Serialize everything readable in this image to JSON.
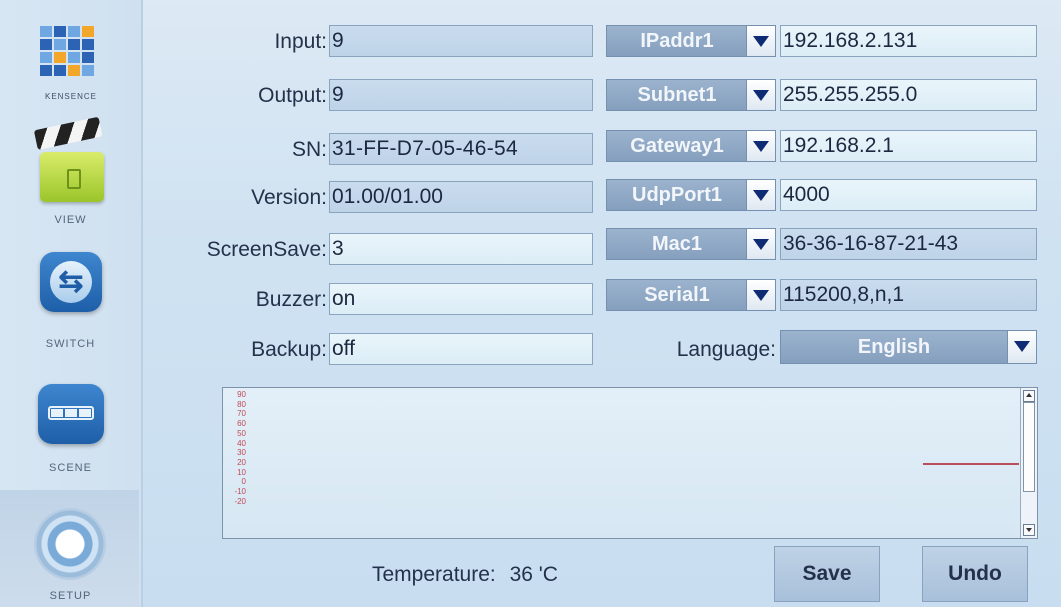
{
  "sidebar": {
    "brand": "KENSENCE",
    "items": [
      {
        "label": "VIEW"
      },
      {
        "label": "SWITCH"
      },
      {
        "label": "SCENE"
      },
      {
        "label": "SETUP",
        "selected": true
      }
    ]
  },
  "info": {
    "input_label": "Input:",
    "input_value": "9",
    "output_label": "Output:",
    "output_value": "9",
    "sn_label": "SN:",
    "sn_value": "31-FF-D7-05-46-54",
    "version_label": "Version:",
    "version_value": "01.00/01.00",
    "screensave_label": "ScreenSave:",
    "screensave_value": "3",
    "buzzer_label": "Buzzer:",
    "buzzer_value": "on",
    "backup_label": "Backup:",
    "backup_value": "off"
  },
  "network": {
    "ipaddr_label": "IPaddr1",
    "ipaddr_value": "192.168.2.131",
    "subnet_label": "Subnet1",
    "subnet_value": "255.255.255.0",
    "gateway_label": "Gateway1",
    "gateway_value": "192.168.2.1",
    "udpport_label": "UdpPort1",
    "udpport_value": "4000",
    "mac_label": "Mac1",
    "mac_value": "36-36-16-87-21-43",
    "serial_label": "Serial1",
    "serial_value": "115200,8,n,1",
    "language_label": "Language:",
    "language_value": "English"
  },
  "graph": {
    "axis_ticks": [
      "90",
      "80",
      "70",
      "60",
      "50",
      "40",
      "30",
      "20",
      "10",
      "0",
      "-10",
      "-20"
    ]
  },
  "footer": {
    "temperature_label": "Temperature:",
    "temperature_value": "36 'C",
    "save_label": "Save",
    "undo_label": "Undo"
  },
  "colors": {
    "select_bg": "#8fa8c6",
    "readonly_field": "#c6d9ec",
    "editable_field": "#e4f1f8",
    "trace": "#b8505a"
  }
}
